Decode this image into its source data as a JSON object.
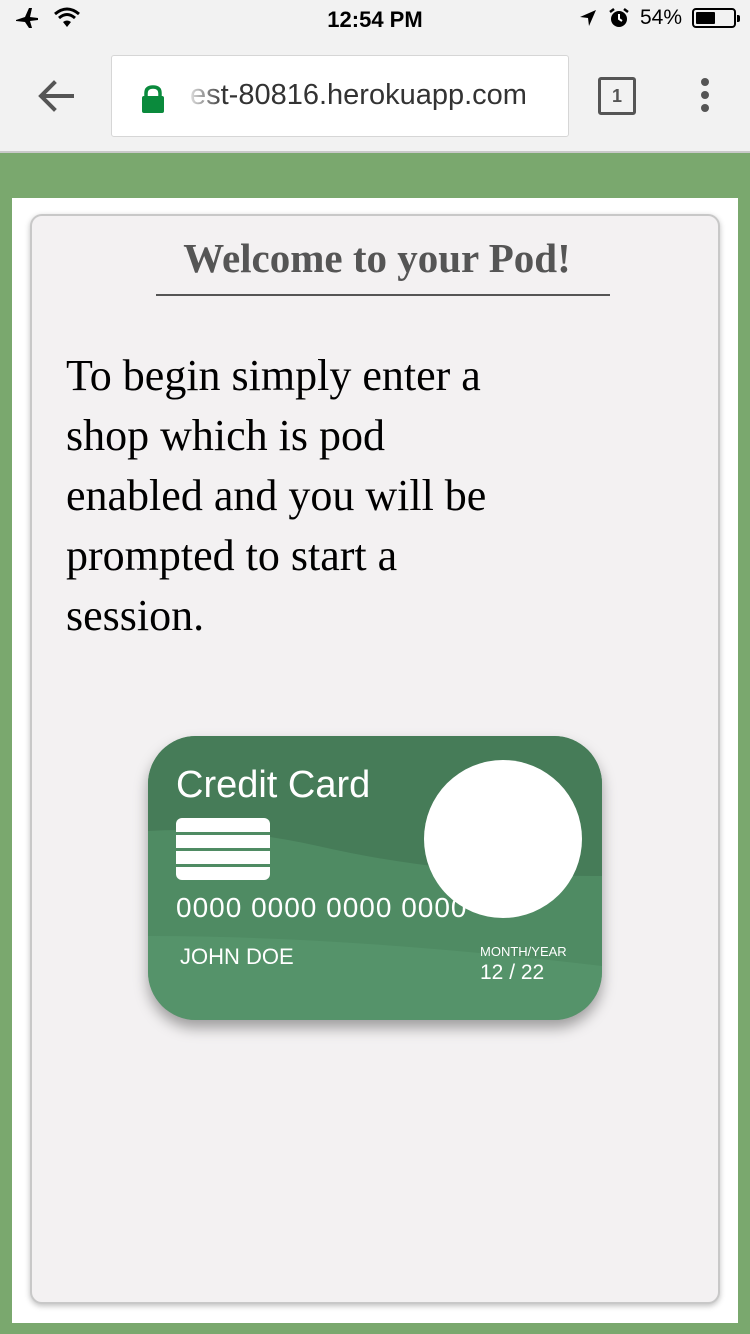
{
  "status_bar": {
    "time": "12:54 PM",
    "battery_text": "54%",
    "battery_level": 0.54
  },
  "browser": {
    "url": "est-80816.herokuapp.com",
    "tab_count": "1"
  },
  "page": {
    "heading": "Welcome to your Pod!",
    "intro": "To begin simply enter a shop which is pod enabled and you will be prompted to start a session."
  },
  "credit_card": {
    "title": "Credit Card",
    "number": "0000 0000 0000 0000",
    "name": "JOHN DOE",
    "expiry_label": "MONTH/YEAR",
    "expiry": "12 / 22"
  },
  "colors": {
    "page_green": "#7aa86e",
    "card_green": "#4f8b63",
    "lock_green": "#0a8a3c"
  }
}
